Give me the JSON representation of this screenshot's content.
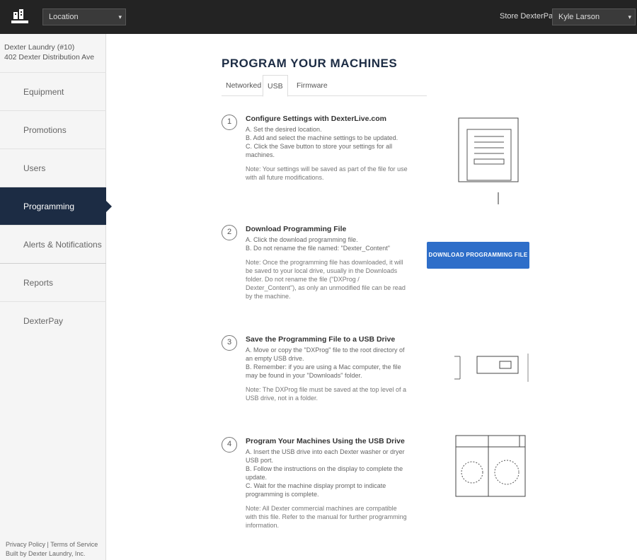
{
  "topbar": {
    "location_select": "Location",
    "dexterpay_link": "Store DexterPay",
    "user_select": "Kyle Larson"
  },
  "sidebar": {
    "store_name": "Dexter Laundry (#10)",
    "store_address": "402 Dexter Distribution Ave",
    "items": [
      {
        "label": "Equipment"
      },
      {
        "label": "Promotions"
      },
      {
        "label": "Users"
      },
      {
        "label": "Programming"
      },
      {
        "label": "Alerts & Notifications"
      },
      {
        "label": "Reports"
      },
      {
        "label": "DexterPay"
      }
    ],
    "footer": {
      "line1": "Privacy Policy | Terms of Service",
      "line2": "Built by Dexter Laundry, Inc."
    }
  },
  "main": {
    "title": "PROGRAM YOUR MACHINES",
    "tabs": [
      {
        "label": "Networked"
      },
      {
        "label": "USB"
      },
      {
        "label": "Firmware"
      }
    ],
    "steps": [
      {
        "num": "1",
        "title": "Configure Settings with DexterLive.com",
        "lines": [
          "A. Set the desired location.",
          "B. Add and select the machine settings to be updated.",
          "C. Click the Save button to store your settings for all machines."
        ],
        "note": "Note: Your settings will be saved as part of the file for use with all future modifications."
      },
      {
        "num": "2",
        "title": "Download Programming File",
        "lines": [
          "A. Click the download programming file.",
          "B. Do not rename the file named: \"Dexter_Content\""
        ],
        "note": "Note: Once the programming file has downloaded, it will be saved to your local drive, usually in the Downloads folder. Do not rename the file (\"DXProg / Dexter_Content\"), as only an unmodified file can be read by the machine."
      },
      {
        "num": "3",
        "title": "Save the Programming File to a USB Drive",
        "lines": [
          "A. Move or copy the \"DXProg\" file to the root directory of an empty USB drive.",
          "B. Remember: if you are using a Mac computer, the file may be found in your \"Downloads\" folder."
        ],
        "note": "Note: The DXProg file must be saved at the top level of a USB drive, not in a folder."
      },
      {
        "num": "4",
        "title": "Program Your Machines Using the USB Drive",
        "lines": [
          "A. Insert the USB drive into each Dexter washer or dryer USB port.",
          "B. Follow the instructions on the display to complete the update.",
          "C. Wait for the machine display prompt to indicate programming is complete."
        ],
        "note": "Note: All Dexter commercial machines are compatible with this file. Refer to the manual for further programming information."
      }
    ],
    "download_button": "DOWNLOAD PROGRAMMING FILE"
  }
}
